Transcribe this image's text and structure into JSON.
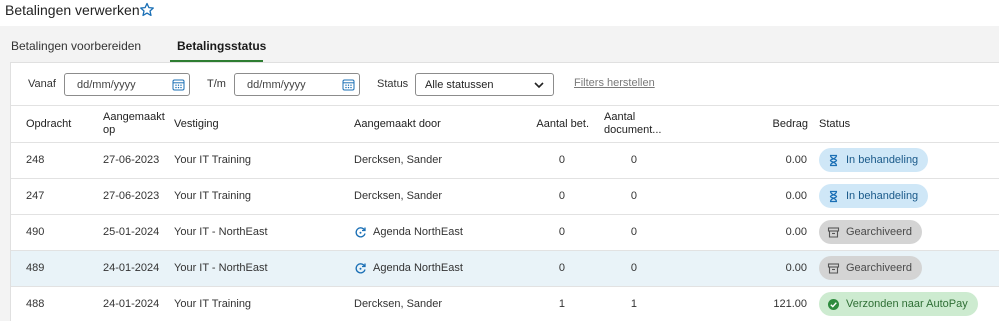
{
  "header": {
    "title": "Betalingen verwerken",
    "favorite_icon": "star-outline-icon"
  },
  "tabs": [
    {
      "label": "Betalingen voorbereiden",
      "active": false
    },
    {
      "label": "Betalingsstatus",
      "active": true
    }
  ],
  "filters": {
    "from_label": "Vanaf",
    "from_placeholder": "dd/mm/yyyy",
    "to_label": "T/m",
    "to_placeholder": "dd/mm/yyyy",
    "status_label": "Status",
    "status_value": "Alle statussen",
    "reset_label": "Filters herstellen"
  },
  "table": {
    "columns": {
      "order": "Opdracht",
      "created_on": "Aangemaakt op",
      "branch": "Vestiging",
      "created_by": "Aangemaakt door",
      "payments": "Aantal bet.",
      "documents": "Aantal document...",
      "amount": "Bedrag",
      "status": "Status"
    },
    "rows": [
      {
        "order": "248",
        "created_on": "27-06-2023",
        "branch": "Your IT Training",
        "created_by": "Dercksen, Sander",
        "payments": "0",
        "documents": "0",
        "amount": "0.00",
        "status": "In behandeling",
        "status_icon": "hourglass-icon"
      },
      {
        "order": "247",
        "created_on": "27-06-2023",
        "branch": "Your IT Training",
        "created_by": "Dercksen, Sander",
        "payments": "0",
        "documents": "0",
        "amount": "0.00",
        "status": "In behandeling",
        "status_icon": "hourglass-icon"
      },
      {
        "order": "490",
        "created_on": "25-01-2024",
        "branch": "Your IT - NorthEast",
        "created_by": "Agenda NorthEast",
        "created_by_icon": "sync-icon",
        "payments": "0",
        "documents": "0",
        "amount": "0.00",
        "status": "Gearchiveerd",
        "status_icon": "archive-icon"
      },
      {
        "order": "489",
        "created_on": "24-01-2024",
        "branch": "Your IT - NorthEast",
        "created_by": "Agenda NorthEast",
        "created_by_icon": "sync-icon",
        "payments": "0",
        "documents": "0",
        "amount": "0.00",
        "status": "Gearchiveerd",
        "status_icon": "archive-icon",
        "selected": true
      },
      {
        "order": "488",
        "created_on": "24-01-2024",
        "branch": "Your IT Training",
        "created_by": "Dercksen, Sander",
        "payments": "1",
        "documents": "1",
        "amount": "121.00",
        "status": "Verzonden naar AutoPay",
        "status_icon": "check-circle-icon"
      }
    ]
  },
  "colors": {
    "accent": "#2e7d32",
    "link_blue": "#1a6fb5",
    "status_blue": "#cfe7f7",
    "status_gray": "#d4d4d4",
    "status_green": "#cdebd0",
    "selected_row": "#e9f3f8"
  }
}
